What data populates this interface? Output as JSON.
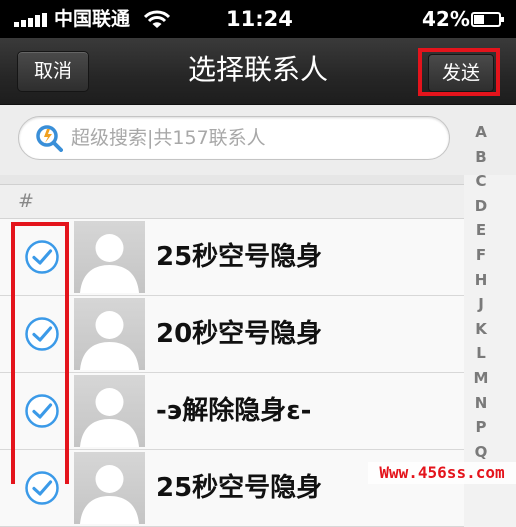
{
  "status_bar": {
    "carrier": "中国联通",
    "time": "11:24",
    "battery": "42%"
  },
  "nav": {
    "cancel_label": "取消",
    "title": "选择联系人",
    "send_label": "发送"
  },
  "search": {
    "placeholder": "超级搜索|共157联系人"
  },
  "index_letters": [
    "A",
    "B",
    "C",
    "D",
    "E",
    "F",
    "H",
    "J",
    "K",
    "L",
    "M",
    "N",
    "P",
    "Q"
  ],
  "section": {
    "header": "#"
  },
  "contacts": [
    {
      "name": "25秒空号隐身",
      "checked": true
    },
    {
      "name": "20秒空号隐身",
      "checked": true
    },
    {
      "name": "-э解除隐身ɛ-",
      "checked": true
    },
    {
      "name": "25秒空号隐身",
      "checked": true
    }
  ],
  "watermark": "Www.456ss.com",
  "colors": {
    "highlight": "#e4141c",
    "check_blue": "#3b9ae8",
    "navbar": "#262626"
  }
}
